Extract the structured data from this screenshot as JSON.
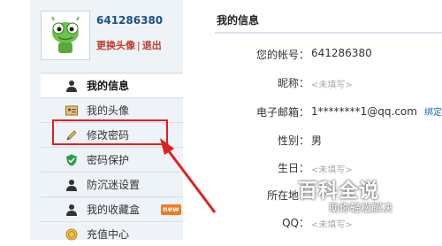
{
  "profile": {
    "username": "641286380",
    "change_avatar": "更换头像",
    "separator": "|",
    "logout": "退出"
  },
  "sidebar": {
    "items": [
      {
        "label": "我的信息",
        "icon": "user-icon"
      },
      {
        "label": "我的头像",
        "icon": "id-card-icon"
      },
      {
        "label": "修改密码",
        "icon": "pencil-icon"
      },
      {
        "label": "密码保护",
        "icon": "shield-check-icon"
      },
      {
        "label": "防沉迷设置",
        "icon": "user-icon"
      },
      {
        "label": "我的收藏盒",
        "icon": "user-icon",
        "badge": "new"
      },
      {
        "label": "充值中心",
        "icon": "coin-icon"
      }
    ],
    "active_index": 0
  },
  "main": {
    "title": "我的信息",
    "fields": [
      {
        "label": "您的帐号：",
        "value": "641286380"
      },
      {
        "label": "昵称：",
        "value": "<未填写>"
      },
      {
        "label": "电子邮箱：",
        "value": "1********1@qq.com",
        "link": "绑定"
      },
      {
        "label": "性别：",
        "value": "男"
      },
      {
        "label": "生日：",
        "value": "<未填写>"
      },
      {
        "label": "所在地：",
        "value": ""
      },
      {
        "label": "QQ：",
        "value": "<未填写>"
      }
    ]
  },
  "watermark": {
    "title": "百科全说",
    "subtitle": "助你轻松解决"
  },
  "colors": {
    "sidebar_bg": "#eef3f8",
    "link_blue": "#1a62b5",
    "annotation_red": "#e02020",
    "username_blue": "#1a4f8b"
  }
}
